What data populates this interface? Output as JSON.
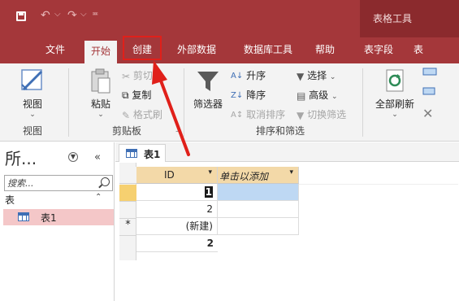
{
  "titlebar": {
    "context_tab_group": "表格工具"
  },
  "ribbon_tabs": [
    "文件",
    "开始",
    "创建",
    "外部数据",
    "数据库工具",
    "帮助",
    "表字段",
    "表"
  ],
  "ribbon": {
    "views": {
      "view_label": "视图",
      "group_label": "视图"
    },
    "clipboard": {
      "paste_label": "粘贴",
      "cut_label": "剪切",
      "copy_label": "复制",
      "format_painter_label": "格式刷",
      "group_label": "剪贴板"
    },
    "sort_filter": {
      "filter_label": "筛选器",
      "ascending_label": "升序",
      "descending_label": "降序",
      "remove_sort_label": "取消排序",
      "selection_label": "选择",
      "advanced_label": "高级",
      "toggle_filter_label": "切换筛选",
      "group_label": "排序和筛选"
    },
    "records": {
      "refresh_all_label": "全部刷新"
    }
  },
  "nav_pane": {
    "title": "所...",
    "search_placeholder": "搜索...",
    "section_label": "表",
    "items": [
      {
        "label": "表1"
      }
    ]
  },
  "document": {
    "tab_label": "表1",
    "columns": [
      "ID",
      "单击以添加"
    ],
    "rows": [
      {
        "id": "1",
        "current": true
      },
      {
        "id": "2",
        "current": false
      }
    ],
    "new_row_marker": "*",
    "new_row_label": "(新建)",
    "new_row_value": "2"
  }
}
